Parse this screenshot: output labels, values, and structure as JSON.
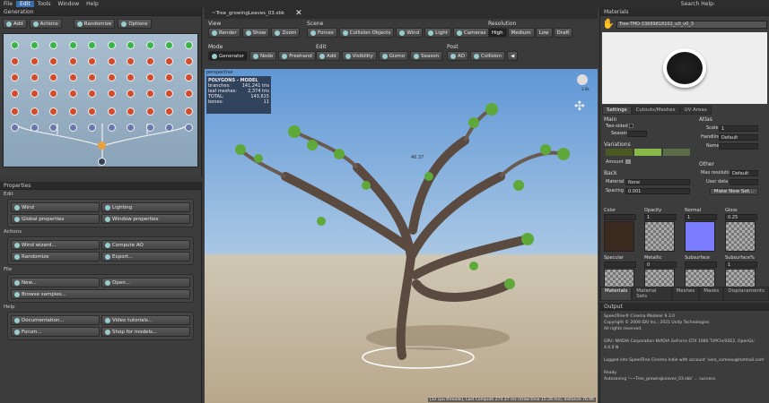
{
  "menu": [
    "File",
    "Edit",
    "Tools",
    "Window",
    "Help"
  ],
  "search_help": "Search Help:",
  "generation": {
    "title": "Generation",
    "add": "Add",
    "actions": "Actions",
    "randomize": "Randomize",
    "options": "Options"
  },
  "properties": {
    "title": "Properties",
    "edit": {
      "label": "Edit",
      "wind": "Wind",
      "lighting": "Lighting",
      "global": "Global properties",
      "window": "Window properties"
    },
    "actions": {
      "label": "Actions",
      "wind_wizard": "Wind wizard...",
      "compute_ao": "Compute AO",
      "randomize": "Randomize",
      "export": "Export..."
    },
    "file": {
      "label": "File",
      "new": "New...",
      "open": "Open...",
      "browse": "Browse samples..."
    },
    "help": {
      "label": "Help",
      "docs": "Documentation...",
      "video": "Video tutorials...",
      "forum": "Forum...",
      "shop": "Shop for models..."
    }
  },
  "doc_tab": "~Tree_growingLeaves_03.sbk",
  "toolbar": {
    "view": {
      "label": "View",
      "render": "Render",
      "show": "Show",
      "zoom": "Zoom"
    },
    "scene": {
      "label": "Scene",
      "forces": "Forces",
      "collision": "Collision Objects",
      "wind": "Wind",
      "light": "Light",
      "cameras": "Cameras"
    },
    "resolution": {
      "label": "Resolution",
      "high": "High",
      "medium": "Medium",
      "low": "Low",
      "draft": "Draft"
    },
    "mode": {
      "label": "Mode",
      "generator": "Generator",
      "node": "Node",
      "freehand": "Freehand"
    },
    "edit": {
      "label": "Edit",
      "add": "Add",
      "visibility": "Visibility",
      "gizmo": "Gizmo",
      "season": "Season"
    },
    "post": {
      "label": "Post",
      "ao": "AO",
      "collision": "Collision"
    }
  },
  "viewport": {
    "perspective": "perspective",
    "stats_title": "POLYGONS - MODEL",
    "stats": [
      {
        "k": "branches:",
        "v": "141,241 tris"
      },
      {
        "k": "leaf meshes:",
        "v": "2,374 tris"
      },
      {
        "k": "TOTAL:",
        "v": "143,615"
      },
      {
        "k": "bones:",
        "v": "11"
      }
    ],
    "height": "46.37",
    "fps": "3.9k",
    "status": "[32 cpu threads], Last Compute 274.37 ms (draw time 15.28 ms), distance 76.96"
  },
  "materials": {
    "title": "Materials",
    "name": "Tree-TMD-33689818102_u0_v0_3",
    "tabs": [
      "Settings",
      "Cutouts/Meshes",
      "UV Areas"
    ],
    "main_label": "Main",
    "two_sided": "Two-sided",
    "season": "Season",
    "variations": "Variations",
    "amount": "Amount",
    "back": "Back",
    "back_material": "Material",
    "back_material_val": "None",
    "spacing": "Spacing",
    "spacing_val": "0.001",
    "atlas": "Atlas",
    "scale": "Scale",
    "scale_val": "1",
    "handling": "Handling",
    "handling_val": "Default",
    "name_lbl": "Name",
    "other": "Other",
    "max_res": "Max resolution",
    "max_res_val": "Default",
    "user_data": "User data",
    "make_set": "Make New Set...",
    "maps": [
      {
        "n": "Color",
        "v": ""
      },
      {
        "n": "Opacity",
        "v": "1"
      },
      {
        "n": "Normal",
        "v": "1"
      },
      {
        "n": "Gloss",
        "v": "0.25"
      },
      {
        "n": "Specular",
        "v": ""
      },
      {
        "n": "Metallic",
        "v": "0"
      },
      {
        "n": "Subsurface",
        "v": ""
      },
      {
        "n": "Subsurface%",
        "v": "1"
      }
    ],
    "bottom_tabs": [
      "Materials",
      "Material Sets",
      "Meshes",
      "Masks",
      "Displacements"
    ]
  },
  "output": {
    "title": "Output",
    "lines": [
      "SpeedTree® Cinema Modeler 9.3.0",
      "Copyright © 2009 IDV Inc.; 2021 Unity Technologies",
      "All rights reserved.",
      "",
      "GPU: NVIDIA Corporation NVIDIA GeForce GTX 1080 Ti/PCIe/SSE2, OpenGL: 4.6.0 N",
      "",
      "Logged into SpeedTree Cinema Indie with account 'vero_comeau@hotmail.com'",
      "",
      "Ready.",
      "Autosaving '~~Tree_growingLeaves_03.sbk' ... success."
    ]
  }
}
